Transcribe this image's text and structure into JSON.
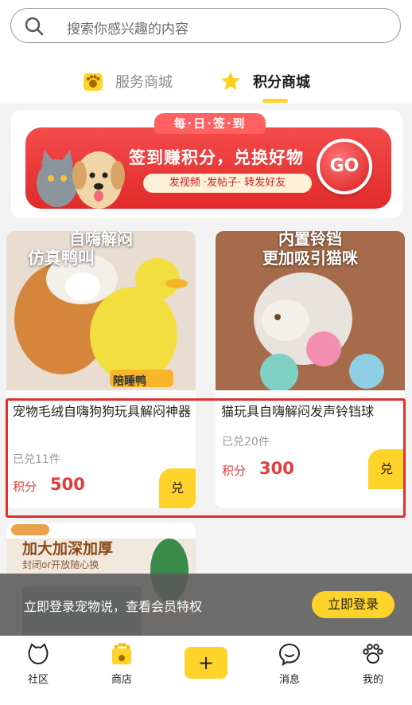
{
  "search": {
    "placeholder": "搜索你感兴趣的内容"
  },
  "tabs": [
    {
      "label": "服务商城",
      "icon": "paw-badge-icon",
      "active": false
    },
    {
      "label": "积分商城",
      "icon": "star-icon",
      "active": true
    }
  ],
  "banner": {
    "top_tab": "每·日·签·到",
    "title": "签到赚积分，兑换好物",
    "subtitle": "发视频 ·发帖子· 转发好友",
    "go": "GO"
  },
  "products": [
    {
      "image_text": [
        "自嗨解闷",
        "仿真鸭叫"
      ],
      "image_tag": "陪睡鸭",
      "title": "宠物毛绒自嗨狗狗玩具解闷神器",
      "sold": "已兑11件",
      "price_label": "积分",
      "price": "500",
      "redeem": "兑"
    },
    {
      "image_text": [
        "内置铃铛",
        "更加吸引猫咪"
      ],
      "title": "猫玩具自嗨解闷发声铃铛球",
      "sold": "已兑20件",
      "price_label": "积分",
      "price": "300",
      "redeem": "兑"
    },
    {
      "image_text": [
        "加大加深加厚",
        "封闭or开放随心换"
      ]
    }
  ],
  "login_bar": {
    "text": "立即登录宠物说，查看会员特权",
    "button": "立即登录"
  },
  "tabbar": [
    {
      "label": "社区",
      "icon": "cat-face-icon"
    },
    {
      "label": "商店",
      "icon": "shop-paw-icon"
    },
    {
      "label": "+",
      "icon": "plus-icon"
    },
    {
      "label": "消息",
      "icon": "chat-bubble-icon"
    },
    {
      "label": "我的",
      "icon": "paw-icon"
    }
  ],
  "colors": {
    "accent": "#ffd32a",
    "price": "#e23b3b",
    "highlight": "#e03131"
  }
}
